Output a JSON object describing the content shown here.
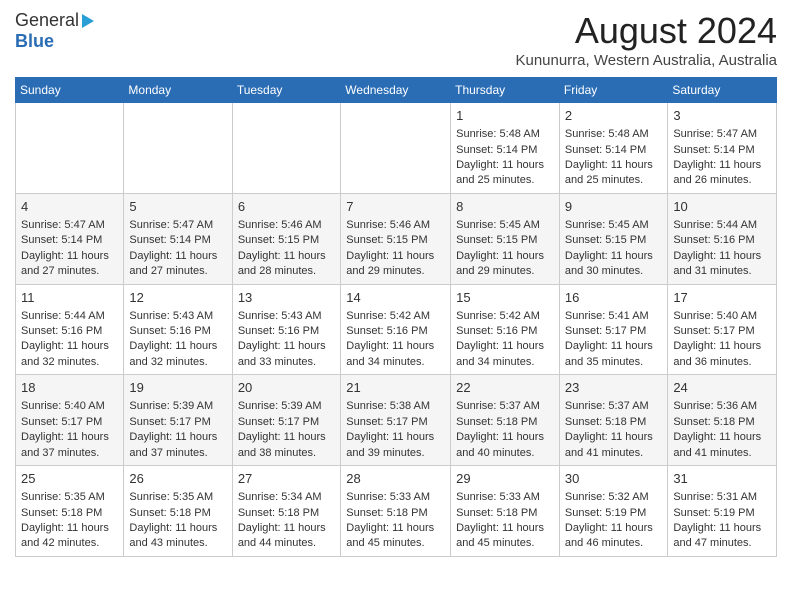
{
  "header": {
    "logo_general": "General",
    "logo_blue": "Blue",
    "title": "August 2024",
    "subtitle": "Kununurra, Western Australia, Australia"
  },
  "days_of_week": [
    "Sunday",
    "Monday",
    "Tuesday",
    "Wednesday",
    "Thursday",
    "Friday",
    "Saturday"
  ],
  "weeks": [
    [
      {
        "day": "",
        "text": ""
      },
      {
        "day": "",
        "text": ""
      },
      {
        "day": "",
        "text": ""
      },
      {
        "day": "",
        "text": ""
      },
      {
        "day": "1",
        "text": "Sunrise: 5:48 AM\nSunset: 5:14 PM\nDaylight: 11 hours\nand 25 minutes."
      },
      {
        "day": "2",
        "text": "Sunrise: 5:48 AM\nSunset: 5:14 PM\nDaylight: 11 hours\nand 25 minutes."
      },
      {
        "day": "3",
        "text": "Sunrise: 5:47 AM\nSunset: 5:14 PM\nDaylight: 11 hours\nand 26 minutes."
      }
    ],
    [
      {
        "day": "4",
        "text": "Sunrise: 5:47 AM\nSunset: 5:14 PM\nDaylight: 11 hours\nand 27 minutes."
      },
      {
        "day": "5",
        "text": "Sunrise: 5:47 AM\nSunset: 5:14 PM\nDaylight: 11 hours\nand 27 minutes."
      },
      {
        "day": "6",
        "text": "Sunrise: 5:46 AM\nSunset: 5:15 PM\nDaylight: 11 hours\nand 28 minutes."
      },
      {
        "day": "7",
        "text": "Sunrise: 5:46 AM\nSunset: 5:15 PM\nDaylight: 11 hours\nand 29 minutes."
      },
      {
        "day": "8",
        "text": "Sunrise: 5:45 AM\nSunset: 5:15 PM\nDaylight: 11 hours\nand 29 minutes."
      },
      {
        "day": "9",
        "text": "Sunrise: 5:45 AM\nSunset: 5:15 PM\nDaylight: 11 hours\nand 30 minutes."
      },
      {
        "day": "10",
        "text": "Sunrise: 5:44 AM\nSunset: 5:16 PM\nDaylight: 11 hours\nand 31 minutes."
      }
    ],
    [
      {
        "day": "11",
        "text": "Sunrise: 5:44 AM\nSunset: 5:16 PM\nDaylight: 11 hours\nand 32 minutes."
      },
      {
        "day": "12",
        "text": "Sunrise: 5:43 AM\nSunset: 5:16 PM\nDaylight: 11 hours\nand 32 minutes."
      },
      {
        "day": "13",
        "text": "Sunrise: 5:43 AM\nSunset: 5:16 PM\nDaylight: 11 hours\nand 33 minutes."
      },
      {
        "day": "14",
        "text": "Sunrise: 5:42 AM\nSunset: 5:16 PM\nDaylight: 11 hours\nand 34 minutes."
      },
      {
        "day": "15",
        "text": "Sunrise: 5:42 AM\nSunset: 5:16 PM\nDaylight: 11 hours\nand 34 minutes."
      },
      {
        "day": "16",
        "text": "Sunrise: 5:41 AM\nSunset: 5:17 PM\nDaylight: 11 hours\nand 35 minutes."
      },
      {
        "day": "17",
        "text": "Sunrise: 5:40 AM\nSunset: 5:17 PM\nDaylight: 11 hours\nand 36 minutes."
      }
    ],
    [
      {
        "day": "18",
        "text": "Sunrise: 5:40 AM\nSunset: 5:17 PM\nDaylight: 11 hours\nand 37 minutes."
      },
      {
        "day": "19",
        "text": "Sunrise: 5:39 AM\nSunset: 5:17 PM\nDaylight: 11 hours\nand 37 minutes."
      },
      {
        "day": "20",
        "text": "Sunrise: 5:39 AM\nSunset: 5:17 PM\nDaylight: 11 hours\nand 38 minutes."
      },
      {
        "day": "21",
        "text": "Sunrise: 5:38 AM\nSunset: 5:17 PM\nDaylight: 11 hours\nand 39 minutes."
      },
      {
        "day": "22",
        "text": "Sunrise: 5:37 AM\nSunset: 5:18 PM\nDaylight: 11 hours\nand 40 minutes."
      },
      {
        "day": "23",
        "text": "Sunrise: 5:37 AM\nSunset: 5:18 PM\nDaylight: 11 hours\nand 41 minutes."
      },
      {
        "day": "24",
        "text": "Sunrise: 5:36 AM\nSunset: 5:18 PM\nDaylight: 11 hours\nand 41 minutes."
      }
    ],
    [
      {
        "day": "25",
        "text": "Sunrise: 5:35 AM\nSunset: 5:18 PM\nDaylight: 11 hours\nand 42 minutes."
      },
      {
        "day": "26",
        "text": "Sunrise: 5:35 AM\nSunset: 5:18 PM\nDaylight: 11 hours\nand 43 minutes."
      },
      {
        "day": "27",
        "text": "Sunrise: 5:34 AM\nSunset: 5:18 PM\nDaylight: 11 hours\nand 44 minutes."
      },
      {
        "day": "28",
        "text": "Sunrise: 5:33 AM\nSunset: 5:18 PM\nDaylight: 11 hours\nand 45 minutes."
      },
      {
        "day": "29",
        "text": "Sunrise: 5:33 AM\nSunset: 5:18 PM\nDaylight: 11 hours\nand 45 minutes."
      },
      {
        "day": "30",
        "text": "Sunrise: 5:32 AM\nSunset: 5:19 PM\nDaylight: 11 hours\nand 46 minutes."
      },
      {
        "day": "31",
        "text": "Sunrise: 5:31 AM\nSunset: 5:19 PM\nDaylight: 11 hours\nand 47 minutes."
      }
    ]
  ]
}
